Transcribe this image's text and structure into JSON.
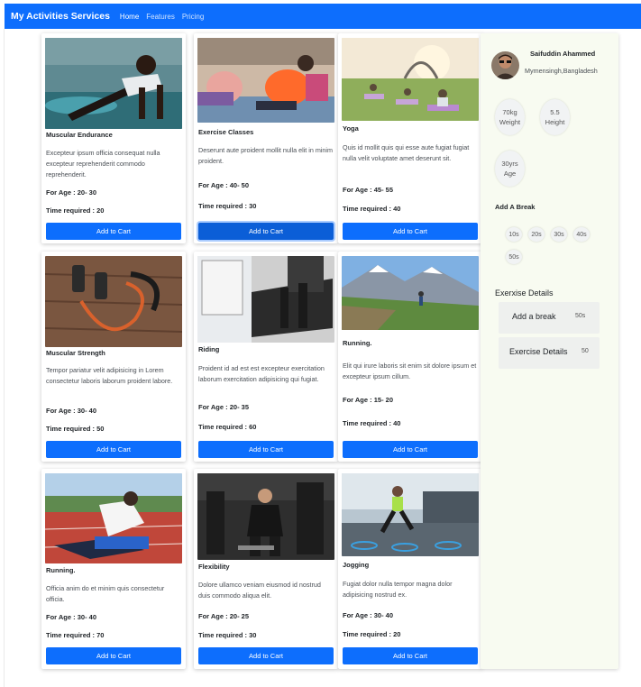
{
  "navbar": {
    "brand": "My Activities Services",
    "links": [
      "Home",
      "Features",
      "Pricing"
    ]
  },
  "activities": [
    {
      "name": "Muscular Endurance",
      "desc": "Excepteur ipsum officia consequat nulla excepteur reprehenderit commodo reprehenderit.",
      "age": "For Age : 20- 30",
      "time": "Time required : 20",
      "button": "Add to Cart",
      "photo": "pushup-photo"
    },
    {
      "name": "Exercise Classes",
      "desc": "Deserunt aute proident mollit nulla elit in minim proident.",
      "age": "For Age : 40- 50",
      "time": "Time required : 30",
      "button": "Add to Cart",
      "photo": "group-stretching-photo"
    },
    {
      "name": "Yoga",
      "desc": "Quis id mollit quis qui esse aute fugiat fugiat nulla velit voluptate amet deserunt sit.",
      "age": "For Age : 45- 55",
      "time": "Time required : 40",
      "button": "Add to Cart",
      "photo": "outdoor-yoga-photo"
    },
    {
      "name": "Muscular Strength",
      "desc": "Tempor pariatur velit adipisicing in Lorem consectetur laboris laborum proident labore.",
      "age": "For Age : 30- 40",
      "time": "Time required : 50",
      "button": "Add to Cart",
      "photo": "dumbbells-photo"
    },
    {
      "name": "Riding",
      "desc": "Proident id ad est est excepteur exercitation laborum exercitation adipisicing qui fugiat.",
      "age": "For Age : 20- 35",
      "time": "Time required : 60",
      "button": "Add to Cart",
      "photo": "treadmill-photo"
    },
    {
      "name": "Running.",
      "desc": "Elit qui irure laboris sit enim sit dolore ipsum et excepteur ipsum cillum.",
      "age": "For Age : 15- 20",
      "time": "Time required : 40",
      "button": "Add to Cart",
      "photo": "mountain-run-photo"
    },
    {
      "name": "Running.",
      "desc": "Officia anim do et minim quis consectetur officia.",
      "age": "For Age : 30- 40",
      "time": "Time required : 70",
      "button": "Add to Cart",
      "photo": "track-stretch-photo"
    },
    {
      "name": "Flexibility",
      "desc": "Dolore ullamco veniam eiusmod id nostrud duis commodo aliqua elit.",
      "age": "For Age : 20- 25",
      "time": "Time required : 30",
      "button": "Add to Cart",
      "photo": "gym-man-photo"
    },
    {
      "name": "Jogging",
      "desc": "Fugiat dolor nulla tempor magna dolor adipisicing nostrud ex.",
      "age": "For Age : 30- 40",
      "time": "Time required : 20",
      "button": "Add to Cart",
      "photo": "jogging-photo"
    }
  ],
  "profile": {
    "name": "Saifuddin Ahammed",
    "location": "Mymensingh,Bangladesh",
    "stats": [
      {
        "value": "70kg",
        "label": "Weight"
      },
      {
        "value": "5.5",
        "label": "Height"
      },
      {
        "value": "30yrs",
        "label": "Age"
      }
    ]
  },
  "break_section": {
    "title": "Add A Break",
    "options": [
      "10s",
      "20s",
      "30s",
      "40s",
      "50s"
    ]
  },
  "exercise_details": {
    "title": "Exerxise Details",
    "rows": [
      {
        "label": "Add a break",
        "value": "50s"
      },
      {
        "label": "Exercise Details",
        "value": "50"
      }
    ]
  },
  "colors": {
    "primary": "#0d6efd",
    "sidebar_bg": "#f8fbf1"
  }
}
